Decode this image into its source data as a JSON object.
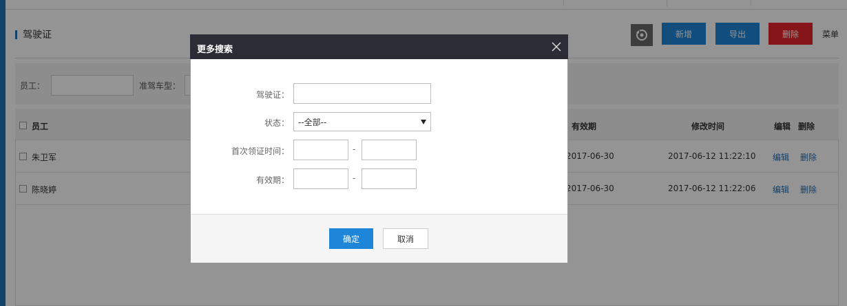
{
  "page": {
    "title": "驾驶证",
    "toolbar": {
      "new_label": "新增",
      "export_label": "导出",
      "delete_label": "删除",
      "menu_label": "菜单"
    },
    "filters": {
      "employee_label": "员工：",
      "vehicle_type_label": "准驾车型："
    },
    "table": {
      "columns": [
        "员工",
        "有效期",
        "修改时间",
        "编辑",
        "删除"
      ],
      "rows": [
        {
          "employee": "朱卫军",
          "valid_until": "2017-06-30",
          "modified": "2017-06-12 11:22:10",
          "edit": "编辑",
          "delete": "删除"
        },
        {
          "employee": "陈晓婷",
          "valid_until": "2017-06-30",
          "modified": "2017-06-12 11:22:06",
          "edit": "编辑",
          "delete": "删除"
        }
      ]
    }
  },
  "dialog": {
    "title": "更多搜索",
    "fields": {
      "license_label": "驾驶证：",
      "license_value": "",
      "status_label": "状态：",
      "status_selected": "--全部--",
      "first_issue_label": "首次领证时间：",
      "first_issue_from": "",
      "first_issue_to": "",
      "validity_label": "有效期：",
      "validity_from": "",
      "validity_to": "",
      "range_separator": "-"
    },
    "ok_label": "确定",
    "cancel_label": "取消"
  },
  "colors": {
    "primary": "#1e86d8",
    "danger": "#e5252a",
    "dialog_header": "#2b2c35",
    "sidebar": "#1e73b4"
  },
  "icons": {
    "tool": "refresh-settings-icon",
    "close": "close-icon",
    "select_arrow": "caret-down-icon"
  }
}
